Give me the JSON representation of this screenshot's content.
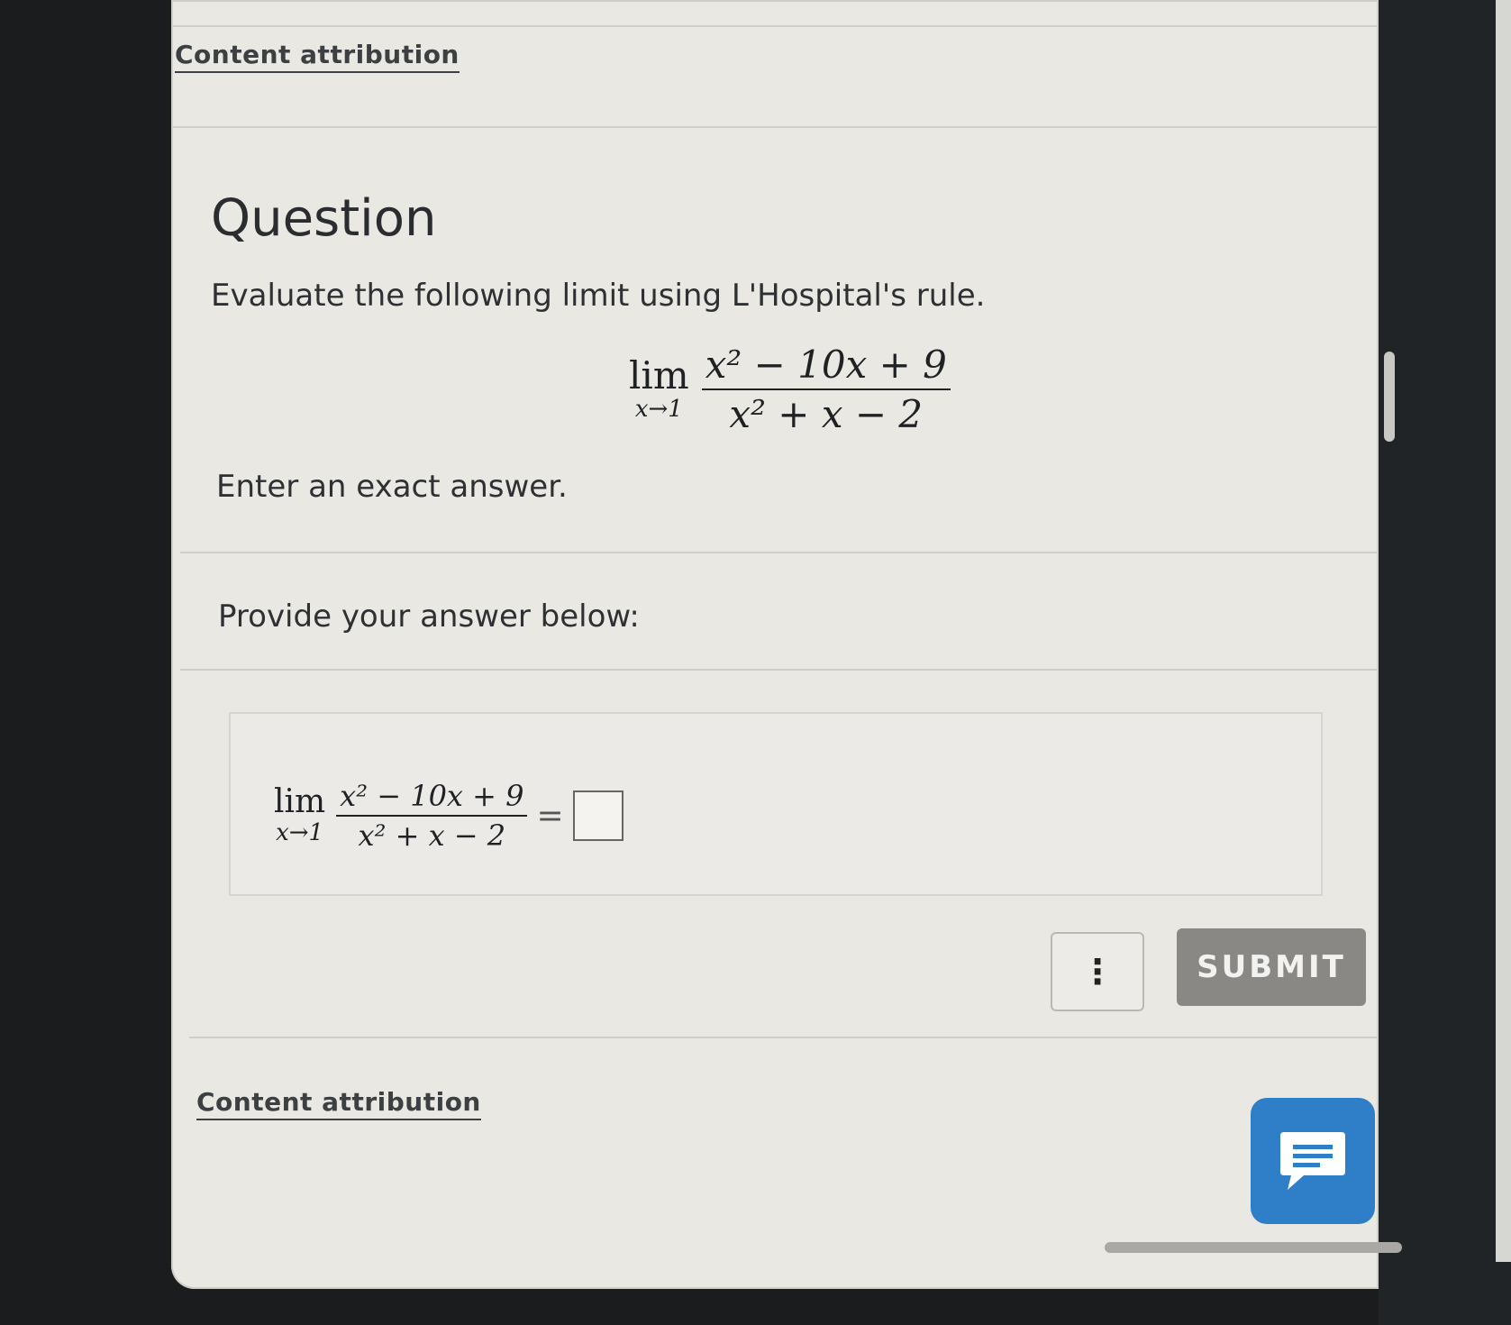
{
  "header": {
    "content_attribution_label": "Content attribution"
  },
  "question": {
    "heading": "Question",
    "prompt": "Evaluate the following limit using L'Hospital's rule.",
    "limit": {
      "lim_label": "lim",
      "approach": "x→1",
      "numerator": "x² − 10x + 9",
      "denominator": "x² + x − 2"
    },
    "instruction": "Enter an exact answer."
  },
  "answer_section": {
    "label": "Provide your answer below:",
    "equals": "=",
    "input_value": ""
  },
  "actions": {
    "more_label": "⋮",
    "submit_label": "SUBMIT",
    "chat_icon": "chat-icon"
  },
  "footer": {
    "content_attribution_label": "Content attribution"
  },
  "colors": {
    "page_background": "#e9e8e3",
    "submit_background": "#8a8885",
    "chat_button": "#2f7ec8"
  }
}
